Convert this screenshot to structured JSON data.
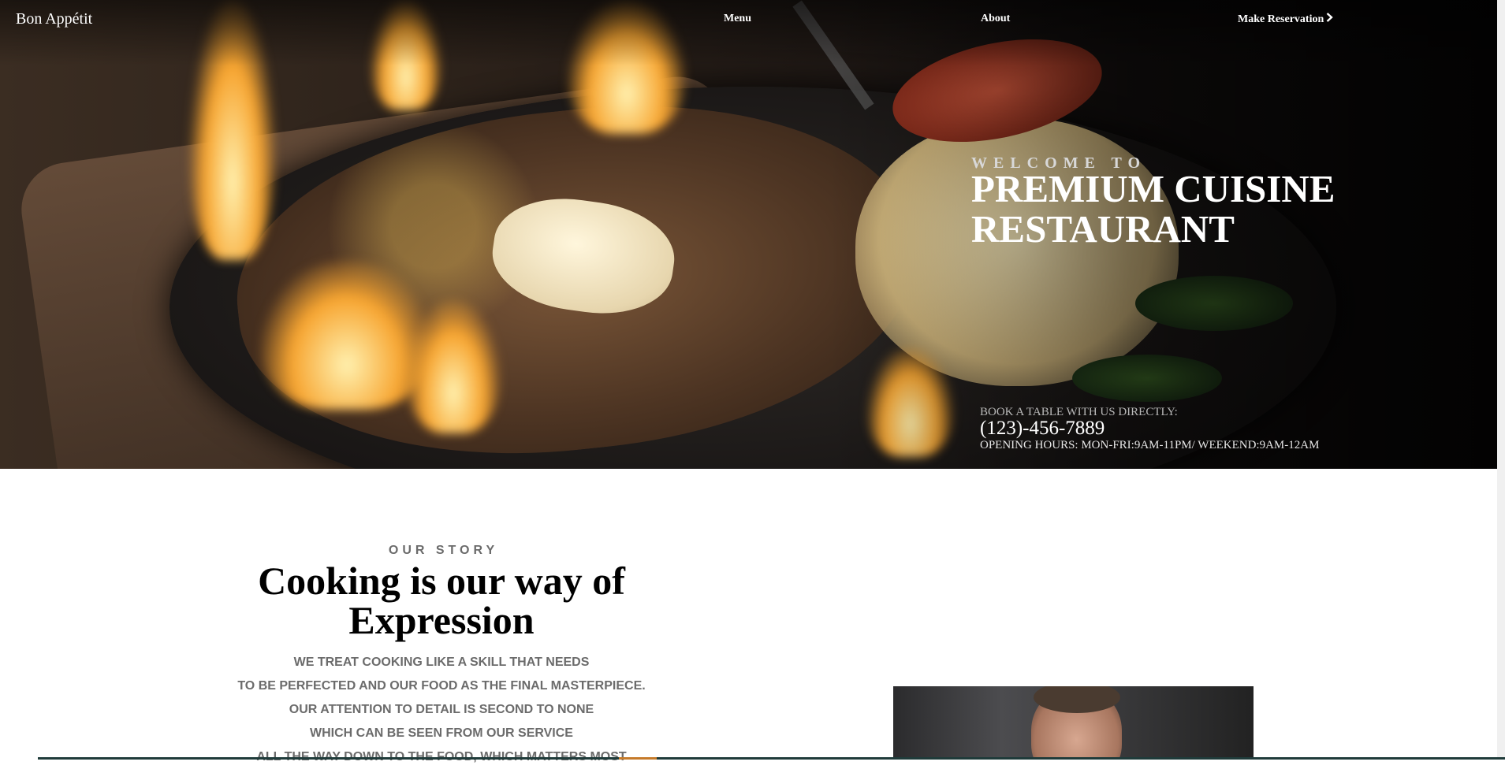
{
  "nav": {
    "brand": "Bon Appétit",
    "links": [
      {
        "label": "Menu"
      },
      {
        "label": "About"
      },
      {
        "label": "Make Reservation"
      }
    ],
    "reservation_icon": "chevron-right-icon"
  },
  "hero": {
    "eyebrow": "WELCOME TO",
    "title_line1": "PREMIUM CUISINE",
    "title_line2": "RESTAURANT",
    "book_label": "BOOK A TABLE WITH US DIRECTLY:",
    "phone": "(123)-456-7889",
    "hours": "OPENING HOURS: MON-FRI:9AM-11PM/ WEEKEND:9AM-12AM"
  },
  "story": {
    "eyebrow": "OUR STORY",
    "title_line1": "Cooking is our way of",
    "title_line2": "Expression",
    "lines": [
      "WE TREAT COOKING LIKE A SKILL THAT NEEDS",
      "TO BE PERFECTED AND OUR FOOD AS THE FINAL MASTERPIECE.",
      "OUR ATTENTION TO DETAIL IS SECOND TO NONE",
      "WHICH CAN BE SEEN FROM OUR SERVICE",
      "ALL THE WAY DOWN TO THE FOOD, WHICH MATTERS MOST"
    ]
  },
  "colors": {
    "hero_text": "#ffffff",
    "muted_text": "#6b6b6b",
    "accent": "#c57a2a",
    "footer_bar": "#1f3b3a"
  }
}
